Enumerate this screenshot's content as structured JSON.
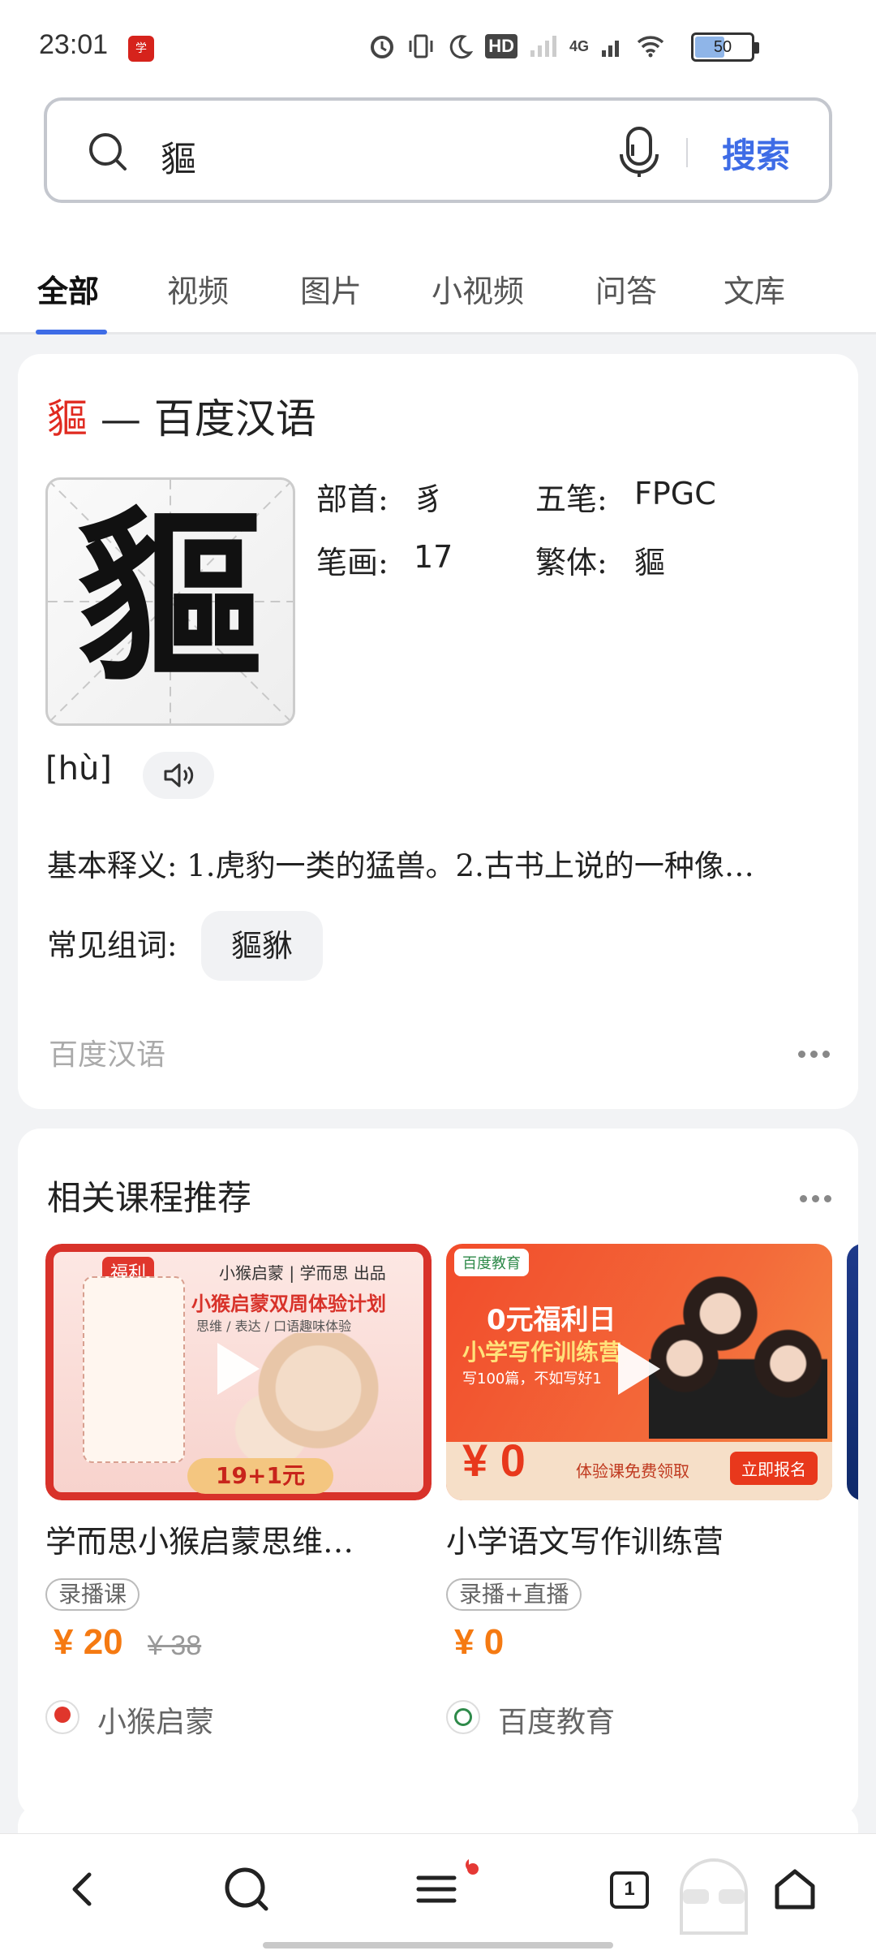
{
  "status": {
    "time": "23:01",
    "battery": "50",
    "network": "4G",
    "hd": "HD"
  },
  "search": {
    "query": "貙",
    "button": "搜索"
  },
  "tabs": [
    {
      "label": "全部"
    },
    {
      "label": "视频"
    },
    {
      "label": "图片"
    },
    {
      "label": "小视频"
    },
    {
      "label": "问答"
    },
    {
      "label": "文库"
    }
  ],
  "dict": {
    "title_char": "貙",
    "title_rest": " — 百度汉语",
    "glyph": "貙",
    "radical_label": "部首:",
    "radical_value": "豸",
    "wubi_label": "五笔:",
    "wubi_value": "FPGC",
    "strokes_label": "笔画:",
    "strokes_value": "17",
    "traditional_label": "繁体:",
    "traditional_value": "貙",
    "pinyin": "[hù]",
    "definition": "基本释义: 1.虎豹一类的猛兽。2.古书上说的一种像…",
    "words_label": "常见组词:",
    "word": "貙貅",
    "source": "百度汉语"
  },
  "courses_section": {
    "title": "相关课程推荐",
    "items": [
      {
        "name": "学而思小猴启蒙思维…",
        "tag": "录播课",
        "price": "¥ 20",
        "price_old": "¥ 38",
        "provider": "小猴启蒙",
        "img_badge": "福利",
        "img_headline": "小猴启蒙双周体验计划",
        "img_sub": "思维 / 表达 / 口语趣味体验",
        "img_brand": "小猴启蒙 | 学而思 出品",
        "img_price": "19+1元"
      },
      {
        "name": "小学语文写作训练营",
        "tag": "录播+直播",
        "price": "¥ 0",
        "price_old": "",
        "provider": "百度教育",
        "img_brand": "百度教育",
        "img_headline": "0元福利日",
        "img_sub": "小学写作训练营",
        "img_sub2": "写100篇，不如写好1",
        "img_zero": "¥ 0",
        "img_free": "体验课免费领取",
        "img_btn": "立即报名"
      }
    ]
  },
  "bottom_nav": {
    "tab_count": "1"
  },
  "colors": {
    "accent": "#3e6ce6",
    "highlight": "#e02a20",
    "price": "#f57a12"
  }
}
